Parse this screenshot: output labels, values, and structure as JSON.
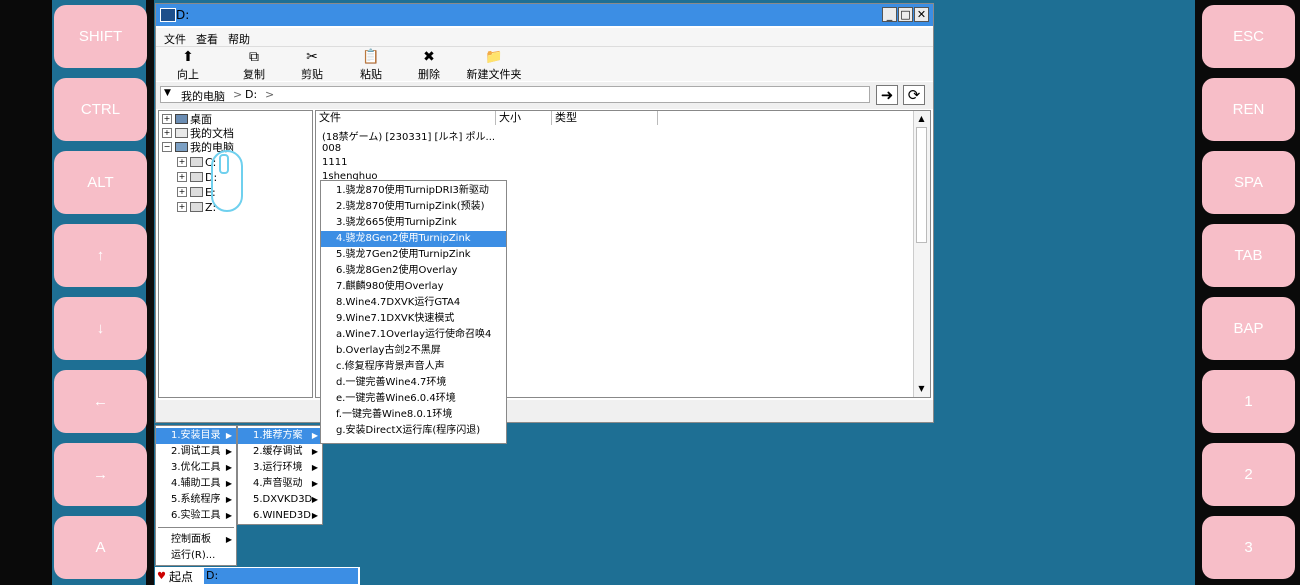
{
  "left_keys": [
    "SHIFT",
    "CTRL",
    "ALT",
    "↑",
    "↓",
    "←",
    "→",
    "A"
  ],
  "right_keys": [
    "ESC",
    "REN",
    "SPA",
    "TAB",
    "BAP",
    "1",
    "2",
    "3"
  ],
  "window": {
    "title": "D:",
    "min": "_",
    "max": "□",
    "close": "✕",
    "menu": [
      "文件",
      "查看",
      "帮助"
    ],
    "toolbar": [
      {
        "icon": "⬆",
        "label": "向上"
      },
      {
        "icon": "⧉",
        "label": "复制"
      },
      {
        "icon": "✂",
        "label": "剪贴"
      },
      {
        "icon": "📋",
        "label": "粘贴"
      },
      {
        "icon": "✖",
        "label": "删除"
      },
      {
        "icon": "📁",
        "label": "新建文件夹"
      }
    ],
    "address": {
      "dropdown": "▼",
      "crumb1": "我的电脑",
      "sep1": ">",
      "crumb2": "D:",
      "sep2": ">",
      "go": "➜",
      "refresh": "⟳"
    },
    "tree": [
      {
        "toggle": "+",
        "label": "桌面"
      },
      {
        "toggle": "+",
        "label": "我的文档"
      },
      {
        "toggle": "−",
        "label": "我的电脑"
      },
      {
        "toggle": "+",
        "label": "C:"
      },
      {
        "toggle": "+",
        "label": "D:"
      },
      {
        "toggle": "+",
        "label": "E:"
      },
      {
        "toggle": "+",
        "label": "Z:"
      }
    ],
    "columns": [
      "文件",
      "大小",
      "类型"
    ],
    "files": [
      "(18禁ゲーム) [230331] [ルネ] ポル...",
      "008",
      "1111",
      "1shenghuo"
    ]
  },
  "start_menu": {
    "items": [
      "1.安装目录",
      "2.调试工具",
      "3.优化工具",
      "4.辅助工具",
      "5.系统程序",
      "6.实验工具"
    ],
    "bottom": [
      "控制面板",
      "运行(R)..."
    ]
  },
  "submenu_1": [
    "1.推荐方案",
    "2.缓存调试",
    "3.运行环境",
    "4.声音驱动",
    "5.DXVKD3D",
    "6.WINED3D"
  ],
  "submenu_2": [
    "1.骁龙870使用TurnipDRI3新驱动",
    "2.骁龙870使用TurnipZink(预装)",
    "3.骁龙665使用TurnipZink",
    "4.骁龙8Gen2使用TurnipZink",
    "5.骁龙7Gen2使用TurnipZink",
    "6.骁龙8Gen2使用Overlay",
    "7.麒麟980使用Overlay",
    "8.Wine4.7DXVK运行GTA4",
    "9.Wine7.1DXVK快速模式",
    "a.Wine7.1Overlay运行使命召唤4",
    "b.Overlay古剑2不黑屏",
    "c.修复程序背景声音人声",
    "d.一键完善Wine4.7环境",
    "e.一键完善Wine6.0.4环境",
    "f.一键完善Wine8.0.1环境",
    "g.安装DirectX运行库(程序闪退)"
  ],
  "taskbar": {
    "start": "起点",
    "task": "D:"
  }
}
